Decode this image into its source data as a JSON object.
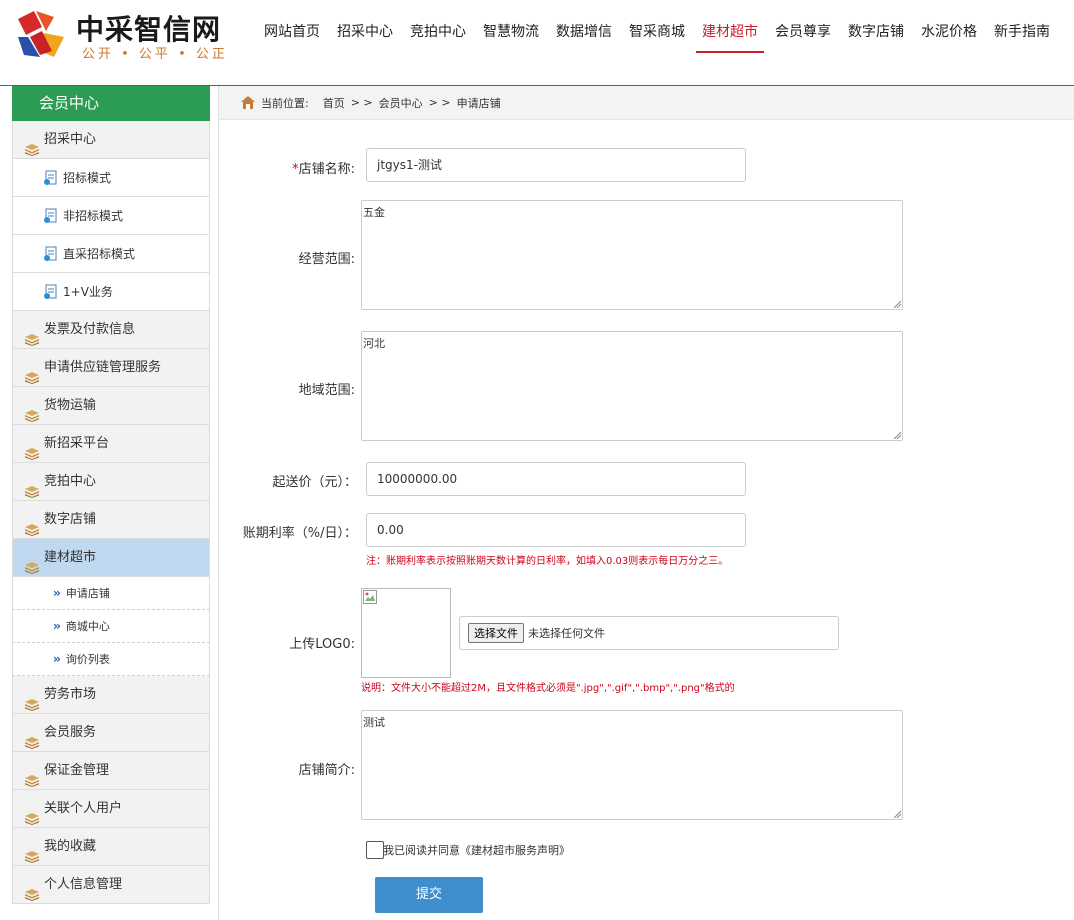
{
  "brand": {
    "title": "中采智信网",
    "slogan": "公开 • 公平 • 公正"
  },
  "nav": [
    {
      "label": "网站首页"
    },
    {
      "label": "招采中心"
    },
    {
      "label": "竞拍中心"
    },
    {
      "label": "智慧物流"
    },
    {
      "label": "数据增信"
    },
    {
      "label": "智采商城"
    },
    {
      "label": "建材超市"
    },
    {
      "label": "会员尊享"
    },
    {
      "label": "数字店铺"
    },
    {
      "label": "水泥价格"
    },
    {
      "label": "新手指南"
    }
  ],
  "nav_active": "建材超市",
  "sidebar": {
    "title": "会员中心",
    "items": [
      {
        "label": "招采中心"
      },
      {
        "label": "招标模式"
      },
      {
        "label": "非招标模式"
      },
      {
        "label": "直采招标模式"
      },
      {
        "label": "1+V业务"
      },
      {
        "label": "发票及付款信息"
      },
      {
        "label": "申请供应链管理服务"
      },
      {
        "label": "货物运输"
      },
      {
        "label": "新招采平台"
      },
      {
        "label": "竞拍中心"
      },
      {
        "label": "数字店铺"
      },
      {
        "label": "建材超市"
      },
      {
        "label": "申请店铺"
      },
      {
        "label": "商城中心"
      },
      {
        "label": "询价列表"
      },
      {
        "label": "劳务市场"
      },
      {
        "label": "会员服务"
      },
      {
        "label": "保证金管理"
      },
      {
        "label": "关联个人用户"
      },
      {
        "label": "我的收藏"
      },
      {
        "label": "个人信息管理"
      }
    ]
  },
  "breadcrumb": {
    "prefix": "当前位置:",
    "home": "首页",
    "sep": "> >",
    "center": "会员中心",
    "current": "申请店铺"
  },
  "form": {
    "required_mark": "*",
    "shop_name_label": "店铺名称:",
    "shop_name_value": "jtgys1-测试",
    "scope_label": "经营范围:",
    "scope_value": "五金",
    "region_label": "地域范围:",
    "region_value": "河北",
    "min_price_label": "起送价（元）：",
    "min_price_value": "10000000.00",
    "rate_label": "账期利率（%/日）：",
    "rate_value": "0.00",
    "rate_note": "注：账期利率表示按照账期天数计算的日利率，如填入0.03则表示每日万分之三。",
    "logo_label": "上传LOG0:",
    "file_button": "选择文件",
    "file_status": "未选择任何文件",
    "logo_note": "说明：文件大小不能超过2M，且文件格式必须是\".jpg\",\".gif\",\".bmp\",\".png\"格式的",
    "intro_label": "店铺简介:",
    "intro_value": "测试",
    "agree_text": "我已阅读并同意《建材超市服务声明》",
    "submit_label": "提交"
  },
  "colors": {
    "brand_green": "#2c9c55",
    "active_red": "#c8202a",
    "submit_blue": "#3f8fcf",
    "note_red": "#d0021b",
    "active_menu": "#c0d8f0"
  }
}
